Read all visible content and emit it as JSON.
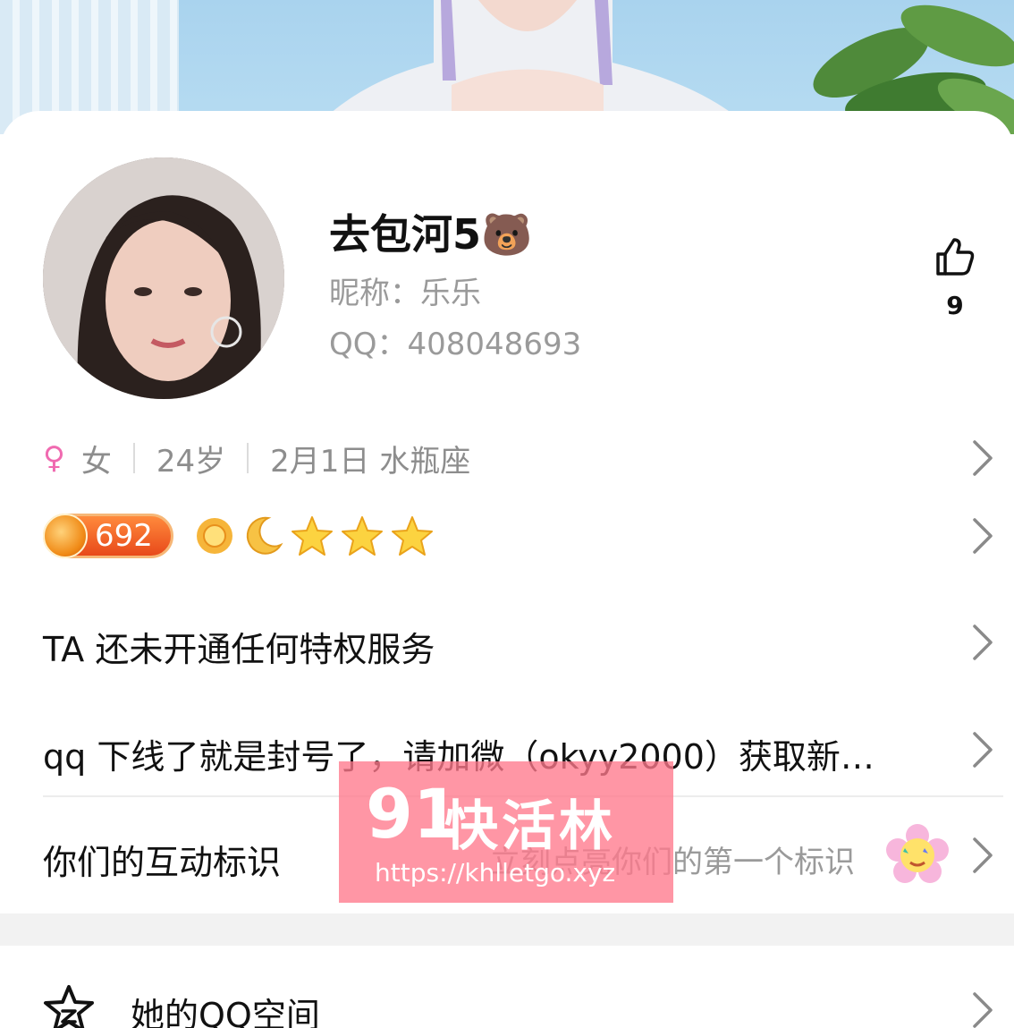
{
  "profile": {
    "name": "去包河5",
    "name_emoji": "🐻",
    "nickname": "昵称：乐乐",
    "qq": "QQ：408048693",
    "likes": "9"
  },
  "info": {
    "gender_symbol": "♀",
    "gender": "女",
    "age": "24岁",
    "birthday": "2月1日 水瓶座"
  },
  "level": {
    "value": "692",
    "icons": [
      "sun-icon",
      "moon-icon",
      "star-icon",
      "star-icon",
      "star-icon"
    ]
  },
  "rows": {
    "privilege": "TA 还未开通任何特权服务",
    "signature": "qq 下线了就是封号了，请加微（okyy2000）获取新…",
    "interaction_label": "你们的互动标识",
    "interaction_hint": "立刻点亮你们的第一个标识"
  },
  "qzone": {
    "label": "她的QQ空间"
  },
  "watermark": {
    "number": "91",
    "title": "快活林",
    "url": "https://khlletgo.xyz"
  },
  "colors": {
    "gender_pink": "#f06ab0",
    "muted_text": "#9a9a9a",
    "level_orange": "#e8491a"
  }
}
